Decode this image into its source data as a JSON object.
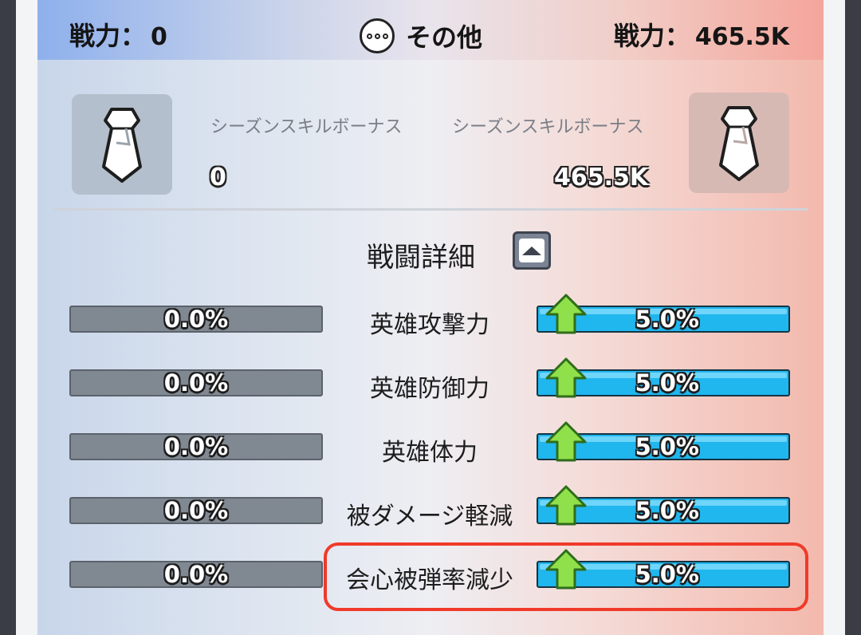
{
  "header": {
    "left_power_label": "戦力：",
    "left_power_value": "0",
    "center_icon": "more-dots-icon",
    "center_label": "その他",
    "right_power_label": "戦力：",
    "right_power_value": "465.5K"
  },
  "bonus": {
    "icon": "necktie-icon",
    "left_label": "シーズンスキルボーナス",
    "left_value": "0",
    "right_label": "シーズンスキルボーナス",
    "right_value": "465.5K"
  },
  "details": {
    "title": "戦闘詳細",
    "toggle_icon": "collapse-up-icon"
  },
  "stats": [
    {
      "label": "英雄攻撃力",
      "left_value": "0.0%",
      "right_value": "5.0%"
    },
    {
      "label": "英雄防御力",
      "left_value": "0.0%",
      "right_value": "5.0%"
    },
    {
      "label": "英雄体力",
      "left_value": "0.0%",
      "right_value": "5.0%"
    },
    {
      "label": "被ダメージ軽減",
      "left_value": "0.0%",
      "right_value": "5.0%"
    },
    {
      "label": "会心被弾率減少",
      "left_value": "0.0%",
      "right_value": "5.0%"
    }
  ],
  "colors": {
    "left_bar": "#808892",
    "right_bar": "#20b6ee",
    "up_arrow": "#8fe04a",
    "highlight": "#f03a2a"
  }
}
